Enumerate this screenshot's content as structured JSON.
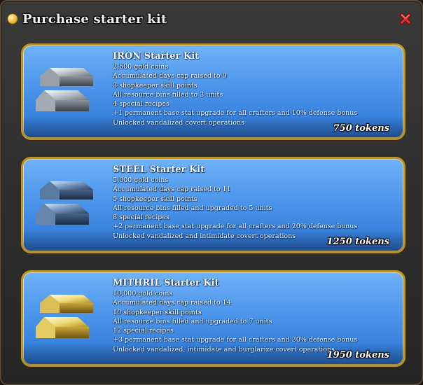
{
  "dialog": {
    "title": "Purchase starter kit",
    "title_icon": "gold-coin-icon",
    "close_icon": "close-x-icon"
  },
  "kits": [
    {
      "name": "IRON Starter Kit",
      "ingot_icon": "iron-ingot-icon",
      "ingot_color": "#c9ced6",
      "lines": [
        "2,500 gold coins",
        "Accumulated days cap raised to 9",
        "3 shopkeeper skill points",
        "All resource bins filled to 3 units",
        "4 special recipes",
        "+1 permanent base stat upgrade for all crafters and 10% defense bonus",
        "Unlocked vandalized covert operations"
      ],
      "price": "750 tokens"
    },
    {
      "name": "STEEL Starter Kit",
      "ingot_icon": "steel-ingot-icon",
      "ingot_color": "#5f7fa6",
      "lines": [
        "5,000 gold coins",
        "Accumulated days cap raised to 11",
        "5 shopkeeper skill points",
        "All resource bins filled and upgraded to 5 units",
        "8 special recipes",
        "+2 permanent base stat upgrade for all crafters and 20% defense bonus",
        "Unlocked vandalized and intimidate covert operations"
      ],
      "price": "1250 tokens"
    },
    {
      "name": "MITHRIL Starter Kit",
      "ingot_icon": "mithril-ingot-icon",
      "ingot_color": "#e8d36a",
      "lines": [
        "10,000 gold coins",
        "Accumulated days cap raised to 14",
        "10 shopkeeper skill points",
        "All resource bins filled and upgraded to 7 units",
        "12 special recipes",
        "+3 permanent base stat upgrade for all crafters and 30% defense bonus",
        "Unlocked vandalized, intimidate and burglarize covert operations"
      ],
      "price": "1950 tokens"
    }
  ]
}
